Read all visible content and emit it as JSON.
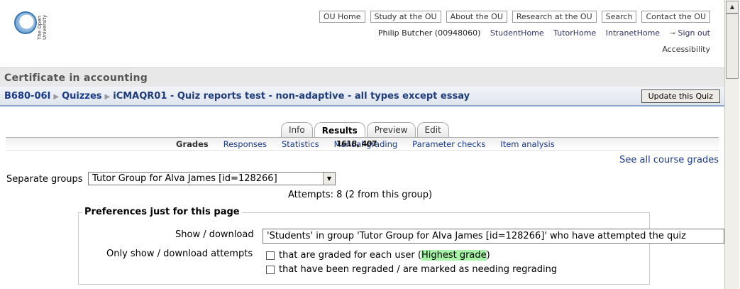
{
  "header": {
    "logo_text": "The Open University",
    "top_links": [
      "OU Home",
      "Study at the OU",
      "About the OU",
      "Research at the OU",
      "Search",
      "Contact the OU"
    ],
    "user_name": "Philip Butcher (00948060)",
    "user_links": [
      "StudentHome",
      "TutorHome",
      "IntranetHome"
    ],
    "sign_out": "Sign out",
    "accessibility": "Accessibility"
  },
  "course": {
    "title": "Certificate in accounting"
  },
  "breadcrumb": [
    "B680-06I",
    "Quizzes",
    "iCMAQR01 - Quiz reports test - non-adaptive - all types except essay"
  ],
  "update_button": "Update this Quiz",
  "tabs": [
    {
      "label": "Info",
      "active": false
    },
    {
      "label": "Results",
      "active": true
    },
    {
      "label": "Preview",
      "active": false
    },
    {
      "label": "Edit",
      "active": false
    }
  ],
  "subtabs": [
    {
      "label": "Grades",
      "active": true
    },
    {
      "label": "Responses",
      "active": false
    },
    {
      "label": "Statistics",
      "active": false
    },
    {
      "label": "Manual grading",
      "active": false
    },
    {
      "label": "Parameter checks",
      "active": false
    },
    {
      "label": "Item analysis",
      "active": false
    }
  ],
  "overlay_text": "1618, 407",
  "see_all": "See all course grades",
  "groups": {
    "label": "Separate groups",
    "selected": "Tutor Group for Alva James [id=128266]"
  },
  "attempts": "Attempts: 8 (2 from this group)",
  "prefs": {
    "legend": "Preferences just for this page",
    "show_label": "Show / download",
    "show_value": "'Students' in group 'Tutor Group for Alva James [id=128266]' who have attempted the quiz",
    "only_label": "Only show / download attempts",
    "option1_prefix": "that are graded for each user (",
    "option1_highlight": "Highest grade",
    "option1_suffix": ")",
    "option2": "that have been regraded / are marked as needing regrading"
  },
  "colors": {
    "link": "#1a3a8a",
    "highlight": "#a6f2a6",
    "nav_border": "#8fa7c7"
  }
}
